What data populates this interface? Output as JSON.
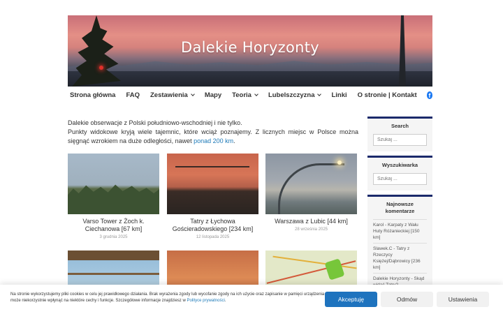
{
  "header": {
    "site_title": "Dalekie Horyzonty"
  },
  "nav": {
    "items": [
      {
        "label": "Strona główna",
        "dropdown": false
      },
      {
        "label": "FAQ",
        "dropdown": false
      },
      {
        "label": "Zestawienia",
        "dropdown": true
      },
      {
        "label": "Mapy",
        "dropdown": false
      },
      {
        "label": "Teoria",
        "dropdown": true
      },
      {
        "label": "Lubelszczyzna",
        "dropdown": true
      },
      {
        "label": "Linki",
        "dropdown": false
      },
      {
        "label": "O stronie | Kontakt",
        "dropdown": false
      }
    ],
    "facebook_icon": "facebook-icon"
  },
  "intro": {
    "line1": "Dalekie obserwacje z Polski południowo-wschodniej i nie tylko.",
    "line2_prefix": "Punkty widokowe kryją wiele tajemnic, które wciąż poznajemy. Z licznych miejsc w Polsce można sięgnąć wzrokiem na duże odległości, nawet ",
    "line2_link": "ponad 200 km",
    "line2_suffix": "."
  },
  "posts": [
    {
      "title": "Varso Tower z Żoch k. Ciechanowa [67 km]",
      "date": "3 grudnia 2025"
    },
    {
      "title": "Tatry z Łychowa Gościeradowskiego [234 km]",
      "date": "12 listopada 2025"
    },
    {
      "title": "Warszawa z Lubic [44 km]",
      "date": "28 września 2025"
    },
    {
      "title": "",
      "date": ""
    },
    {
      "title": "",
      "date": ""
    },
    {
      "title": "",
      "date": ""
    }
  ],
  "sidebar": {
    "search": {
      "heading": "Search",
      "placeholder": "Szukaj ..."
    },
    "search2": {
      "heading": "Wyszukiwarka",
      "placeholder": "Szukaj ..."
    },
    "comments": {
      "heading": "Najnowsze komentarze",
      "items": [
        "Karol - Karpaty z Wału Huty Różanieckiej [150 km]",
        "Slawek.C - Tatry z Rzeczycy Księżej/Dąbrowicy [236 km]",
        "Dalekie Horyzonty - Skąd widać Tatry?"
      ]
    }
  },
  "cookie": {
    "text_prefix": "Na stronie wykorzystujemy pliki cookies w celu jej prawidłowego działania. Brak wyrażenia zgody lub wycofanie zgody na ich użycie oraz zapisanie w pamięci urządzenia może niekorzystnie wpłynąć na niektóre cechy i funkcje. Szczegółowe informacje znajdziesz w ",
    "link": "Polityce prywatności",
    "text_suffix": ".",
    "accept": "Akceptuję",
    "reject": "Odmów",
    "settings": "Ustawienia"
  },
  "colors": {
    "accent": "#1e73be",
    "widget_border": "#1b2a6b",
    "link": "#1e7ab8"
  }
}
